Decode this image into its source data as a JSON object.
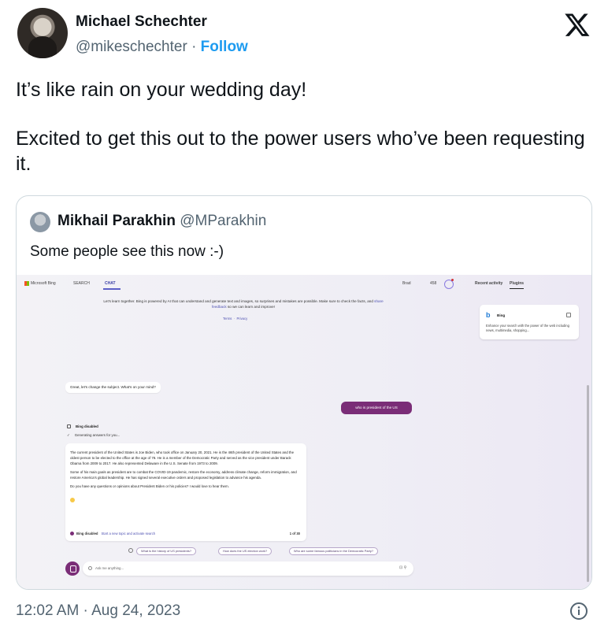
{
  "author": {
    "display_name": "Michael Schechter",
    "handle": "@mikeschechter",
    "separator": "·",
    "follow_label": "Follow"
  },
  "tweet": {
    "paragraphs": [
      "It’s like rain on your wedding day!",
      "Excited to get this out to the power users who’ve been requesting it."
    ]
  },
  "quote": {
    "display_name": "Mikhail Parakhin",
    "handle": "@MParakhin",
    "text": "Some people see this now :-)",
    "screenshot": {
      "topbar": {
        "brand": "Microsoft Bing",
        "tab_search": "SEARCH",
        "tab_chat": "CHAT",
        "lang": "Brad",
        "points": "458",
        "recent_activity": "Recent activity",
        "plugins": "Plugins"
      },
      "disclaimer": {
        "text": "Let's learn together. Bing is powered by AI that can understand and generate text and images, so surprises and mistakes are possible. Make sure to check the facts, and",
        "link": "share feedback",
        "tail": "so we can learn and improve!",
        "terms": "Terms",
        "privacy": "Privacy"
      },
      "plugin_card": {
        "title": "Bing",
        "description": "Enhance your search with the power of the web including news, multimedia, shopping..."
      },
      "messages": {
        "bot_prompt": "Great, let's change the subject. What's on your mind?",
        "user": "who is president of the US",
        "status_disabled": "Bing disabled",
        "status_generating": "Generating answers for you...",
        "answer_paragraphs": [
          "The current president of the United States is Joe Biden, who took office on January 20, 2021. He is the 46th president of the United States and the oldest person to be elected to the office at the age of 78. He is a member of the Democratic Party and served as the vice president under Barack Obama from 2009 to 2017. He also represented Delaware in the U.S. Senate from 1973 to 2009.",
          "Some of his main goals as president are to combat the COVID-19 pandemic, restore the economy, address climate change, reform immigration, and restore America's global leadership. He has signed several executive orders and proposed legislation to advance his agenda.",
          "Do you have any questions or opinions about President Biden or his policies? I would love to hear them."
        ],
        "footer_disabled": "Bing disabled",
        "footer_action": "Start a new topic and activate search",
        "footer_count": "1 of 30"
      },
      "suggestions": [
        "What is the history of US presidents?",
        "How does the US election work?",
        "Who are some famous politicians in the Democratic Party?"
      ],
      "ask_placeholder": "Ask me anything..."
    }
  },
  "timestamp": "12:02 AM · Aug 24, 2023",
  "icons": [
    "x-logo-icon",
    "info-icon",
    "microsoft-logo-icon",
    "rewards-icon",
    "bing-logo-icon",
    "new-topic-icon",
    "chat-input-icon",
    "mic-icon"
  ]
}
